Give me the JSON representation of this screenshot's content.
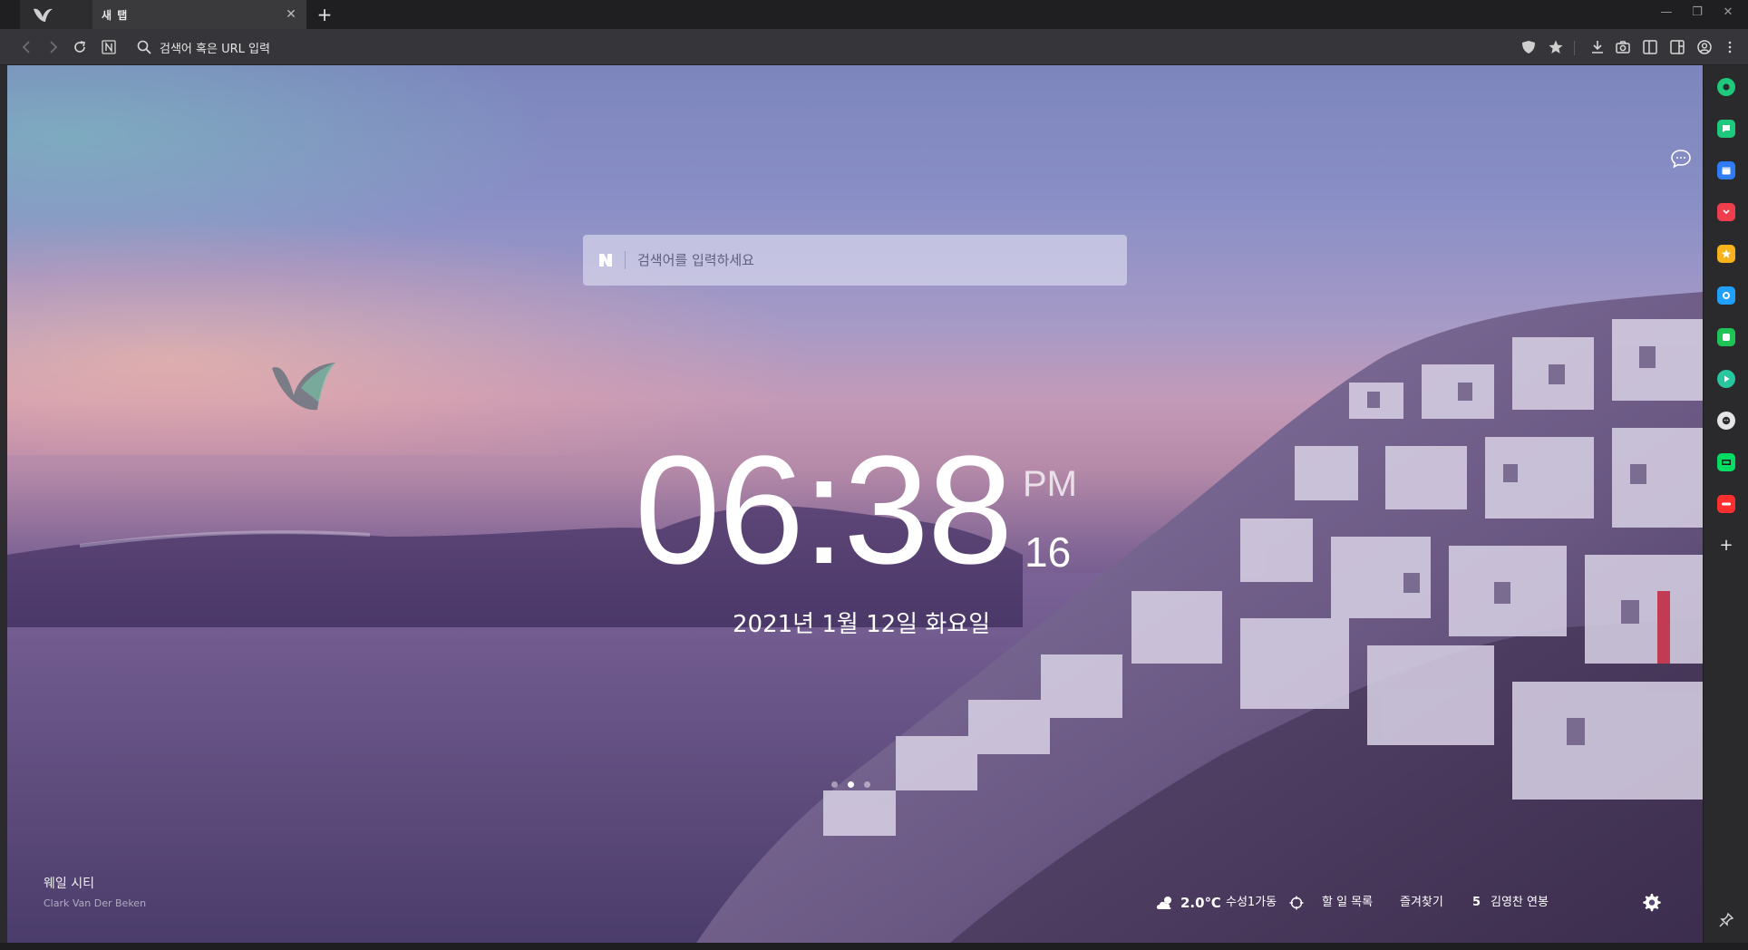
{
  "tabs": [
    {
      "label": "",
      "active": false,
      "icon": "whale-icon"
    },
    {
      "label": "새 탭",
      "active": true,
      "close_icon": "close-icon"
    }
  ],
  "toolbar": {
    "address_value": "검색어 혹은 URL 입력",
    "icons": [
      "back-icon",
      "forward-icon",
      "reload-icon",
      "naver-icon",
      "search-icon",
      "shield-icon",
      "star-icon",
      "download-icon",
      "camera-icon",
      "panel-icon",
      "sidebar-icon",
      "account-icon",
      "menu-icon"
    ]
  },
  "search": {
    "placeholder": "검색어를 입력하세요",
    "logo": "N"
  },
  "clock": {
    "hours_minutes": "06:38",
    "ampm": "PM",
    "seconds": "16"
  },
  "date": "2021년 1월 12일 화요일",
  "wallpaper": {
    "title": "웨일 시티",
    "author": "Clark Van Der Beken"
  },
  "widgets": {
    "weather_temp": "2.0℃",
    "weather_location": "수성1가동",
    "todo_label": "할 일 목록",
    "bookmarks_label": "즐겨찾기",
    "badge_count": "5",
    "contact_label": "김영찬 연봉"
  },
  "sidebar_items": [
    {
      "name": "sidebar-green-circle",
      "color": "#1ec97d"
    },
    {
      "name": "sidebar-chat",
      "color": "#1ec97d"
    },
    {
      "name": "sidebar-calendar",
      "color": "#2f7cf6"
    },
    {
      "name": "sidebar-pocket",
      "color": "#ef3f4f"
    },
    {
      "name": "sidebar-star",
      "color": "#f7b21e"
    },
    {
      "name": "sidebar-translate",
      "color": "#1fa0ff"
    },
    {
      "name": "sidebar-line",
      "color": "#20c456"
    },
    {
      "name": "sidebar-play",
      "color": "#29c7a0"
    },
    {
      "name": "sidebar-github",
      "color": "#e5e5e5"
    },
    {
      "name": "sidebar-webtoon",
      "color": "#00dc64"
    },
    {
      "name": "sidebar-now",
      "color": "#ff2f2f"
    }
  ],
  "colors": {
    "tabbar": "#1f1f21",
    "toolbar": "#36363a",
    "sidebar": "#2a2a2d",
    "accent_green": "#1ec97d"
  },
  "carousel": {
    "count": 3,
    "active": 2
  }
}
